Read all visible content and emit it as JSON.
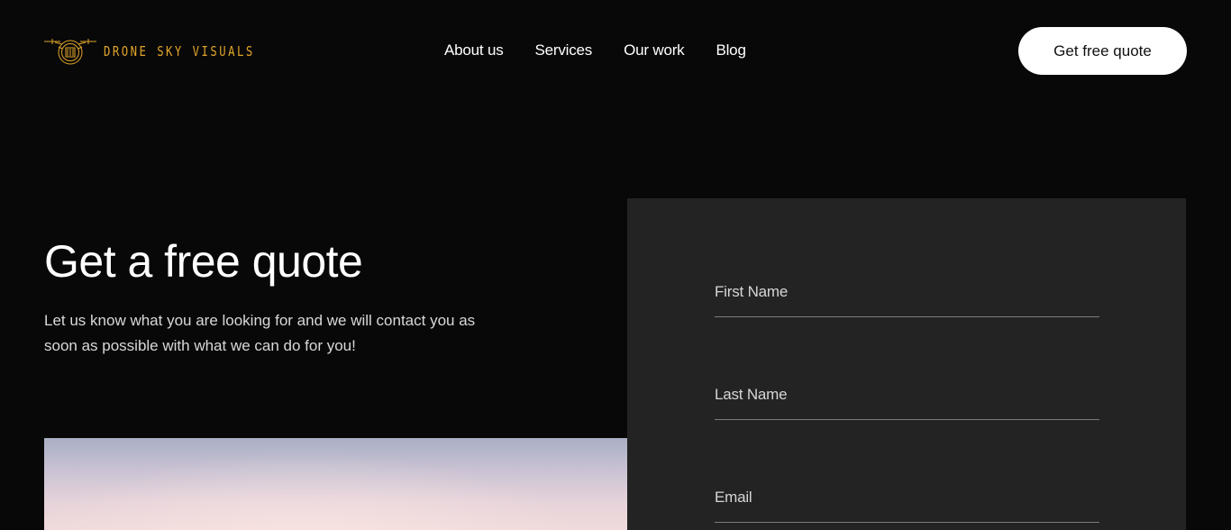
{
  "brand": {
    "name": "DRONE SKY VISUALS",
    "logo_icon": "drone-camera-icon",
    "accent_color": "#e0a52a"
  },
  "nav": {
    "items": [
      {
        "label": "About us"
      },
      {
        "label": "Services"
      },
      {
        "label": "Our work"
      },
      {
        "label": "Blog"
      }
    ]
  },
  "header": {
    "cta_label": "Get free quote"
  },
  "intro": {
    "title": "Get a free quote",
    "text": "Let us know what you are looking for and we will contact you as soon as possible with what we can do for you!"
  },
  "form": {
    "fields": [
      {
        "label": "First Name",
        "value": ""
      },
      {
        "label": "Last Name",
        "value": ""
      },
      {
        "label": "Email",
        "value": ""
      }
    ]
  },
  "colors": {
    "background": "#080808",
    "panel": "#232323",
    "button_bg": "#ffffff"
  }
}
